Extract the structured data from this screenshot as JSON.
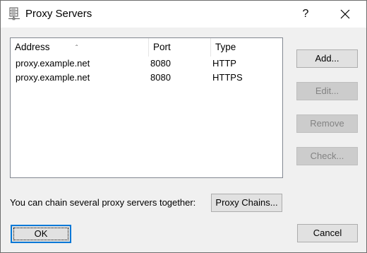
{
  "window": {
    "title": "Proxy Servers",
    "help_label": "?",
    "close_icon": "close-icon"
  },
  "list": {
    "columns": [
      {
        "label": "Address",
        "sorted": "ascending"
      },
      {
        "label": "Port"
      },
      {
        "label": "Type"
      }
    ],
    "rows": [
      {
        "address": "proxy.example.net",
        "port": "8080",
        "type": "HTTP"
      },
      {
        "address": "proxy.example.net",
        "port": "8080",
        "type": "HTTPS"
      }
    ]
  },
  "side_buttons": {
    "add": {
      "label": "Add...",
      "enabled": true
    },
    "edit": {
      "label": "Edit...",
      "enabled": false
    },
    "remove": {
      "label": "Remove",
      "enabled": false
    },
    "check": {
      "label": "Check...",
      "enabled": false
    }
  },
  "chain": {
    "label": "You can chain several proxy servers together:",
    "button_label": "Proxy Chains..."
  },
  "footer": {
    "ok_label": "OK",
    "cancel_label": "Cancel"
  }
}
